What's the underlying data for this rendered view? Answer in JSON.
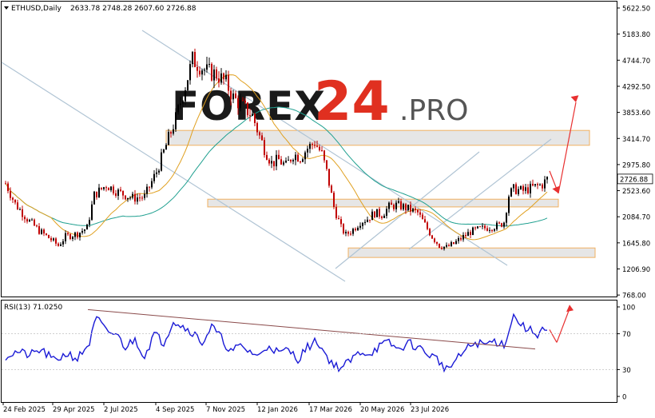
{
  "header": {
    "symbol_text": "ETHUSD,Daily",
    "ohlc_text": "2633.78 2748.28 2607.60 2726.88"
  },
  "watermark": {
    "brand": "FOREX",
    "number": "24",
    "suffix": ".PRO"
  },
  "rsi_header": {
    "label_text": "RSI(13) 71.0250"
  },
  "colors": {
    "bull_candle": "#000000",
    "bear_candle": "#c00000",
    "ma_fast": "#e0a020",
    "ma_slow": "#20a090",
    "channel": "#b0c4d4",
    "zone_fill": "#e6e6e6",
    "zone_border": "#f0b060",
    "rsi_line": "#1a1ad6",
    "rsi_trend": "#8a4a4a",
    "arrow": "#e83030",
    "watermark_brand": "#1a1a1a",
    "watermark_number": "#e03020",
    "watermark_suffix": "#555555"
  },
  "chart_data": [
    {
      "type": "candlestick",
      "title": "ETHUSD,Daily 2633.78 2748.28 2607.60 2726.88",
      "ylim": [
        768.0,
        5622.5
      ],
      "price_ticks": [
        5622.5,
        5183.8,
        4744.7,
        4292.5,
        3853.6,
        3414.7,
        2975.8,
        2523.6,
        2084.7,
        1645.8,
        1206.9,
        768.0
      ],
      "current_price": 2726.88,
      "x_dates": [
        "24 Feb 2025",
        "29 Apr 2025",
        "2 Jul 2025",
        "4 Sep 2025",
        "7 Nov 2025",
        "12 Jan 2026",
        "17 Mar 2026",
        "20 May 2026",
        "23 Jul 2026"
      ],
      "price_path": [
        [
          0,
          2650
        ],
        [
          4,
          2300
        ],
        [
          9,
          2050
        ],
        [
          14,
          1850
        ],
        [
          19,
          1700
        ],
        [
          22,
          1600
        ],
        [
          25,
          1750
        ],
        [
          30,
          1800
        ],
        [
          34,
          1900
        ],
        [
          37,
          2450
        ],
        [
          42,
          2620
        ],
        [
          47,
          2500
        ],
        [
          53,
          2400
        ],
        [
          58,
          2420
        ],
        [
          63,
          2850
        ],
        [
          67,
          3300
        ],
        [
          71,
          3750
        ],
        [
          75,
          4300
        ],
        [
          78,
          4750
        ],
        [
          81,
          4650
        ],
        [
          84,
          4550
        ],
        [
          88,
          4500
        ],
        [
          92,
          4350
        ],
        [
          95,
          4100
        ],
        [
          99,
          3950
        ],
        [
          103,
          3800
        ],
        [
          106,
          3450
        ],
        [
          108,
          3250
        ],
        [
          111,
          3000
        ],
        [
          114,
          3050
        ],
        [
          117,
          2950
        ],
        [
          120,
          3150
        ],
        [
          123,
          3100
        ],
        [
          126,
          3250
        ],
        [
          129,
          3350
        ],
        [
          132,
          3150
        ],
        [
          134,
          2850
        ],
        [
          137,
          2250
        ],
        [
          140,
          1900
        ],
        [
          142,
          1780
        ],
        [
          145,
          1870
        ],
        [
          148,
          2000
        ],
        [
          151,
          2050
        ],
        [
          154,
          2150
        ],
        [
          157,
          2120
        ],
        [
          160,
          2250
        ],
        [
          163,
          2280
        ],
        [
          166,
          2250
        ],
        [
          169,
          2200
        ],
        [
          172,
          2150
        ],
        [
          175,
          1950
        ],
        [
          178,
          1750
        ],
        [
          181,
          1600
        ],
        [
          184,
          1570
        ],
        [
          187,
          1630
        ],
        [
          190,
          1720
        ],
        [
          194,
          1830
        ],
        [
          198,
          1880
        ],
        [
          202,
          1910
        ],
        [
          206,
          1940
        ],
        [
          208,
          2000
        ],
        [
          210,
          2450
        ],
        [
          212,
          2550
        ],
        [
          216,
          2520
        ],
        [
          220,
          2580
        ],
        [
          224,
          2630
        ],
        [
          226,
          2726.88
        ]
      ],
      "zones": [
        {
          "low": 3300,
          "high": 3550
        },
        {
          "low": 2250,
          "high": 2380
        },
        {
          "low": 1400,
          "high": 1560
        }
      ]
    },
    {
      "type": "line",
      "title": "RSI(13) 71.0250",
      "ylim": [
        0,
        100
      ],
      "rsi_ticks": [
        100,
        70,
        30,
        0
      ],
      "current_value": 71.025,
      "rsi_path": [
        [
          0,
          45
        ],
        [
          5,
          50
        ],
        [
          10,
          46
        ],
        [
          15,
          52
        ],
        [
          20,
          40
        ],
        [
          26,
          48
        ],
        [
          30,
          42
        ],
        [
          35,
          60
        ],
        [
          38,
          88
        ],
        [
          42,
          72
        ],
        [
          46,
          70
        ],
        [
          50,
          55
        ],
        [
          54,
          64
        ],
        [
          58,
          45
        ],
        [
          62,
          70
        ],
        [
          66,
          60
        ],
        [
          70,
          85
        ],
        [
          74,
          78
        ],
        [
          78,
          72
        ],
        [
          82,
          60
        ],
        [
          86,
          78
        ],
        [
          90,
          65
        ],
        [
          94,
          50
        ],
        [
          98,
          56
        ],
        [
          102,
          50
        ],
        [
          106,
          45
        ],
        [
          110,
          58
        ],
        [
          114,
          48
        ],
        [
          118,
          52
        ],
        [
          122,
          42
        ],
        [
          126,
          55
        ],
        [
          130,
          62
        ],
        [
          134,
          45
        ],
        [
          137,
          35
        ],
        [
          140,
          32
        ],
        [
          144,
          40
        ],
        [
          148,
          50
        ],
        [
          152,
          48
        ],
        [
          156,
          56
        ],
        [
          160,
          60
        ],
        [
          164,
          52
        ],
        [
          168,
          60
        ],
        [
          172,
          55
        ],
        [
          176,
          48
        ],
        [
          180,
          42
        ],
        [
          184,
          30
        ],
        [
          188,
          40
        ],
        [
          192,
          52
        ],
        [
          196,
          60
        ],
        [
          200,
          58
        ],
        [
          204,
          62
        ],
        [
          208,
          58
        ],
        [
          212,
          90
        ],
        [
          216,
          78
        ],
        [
          220,
          72
        ],
        [
          222,
          70
        ],
        [
          224,
          76
        ],
        [
          226,
          71.025
        ]
      ]
    }
  ]
}
